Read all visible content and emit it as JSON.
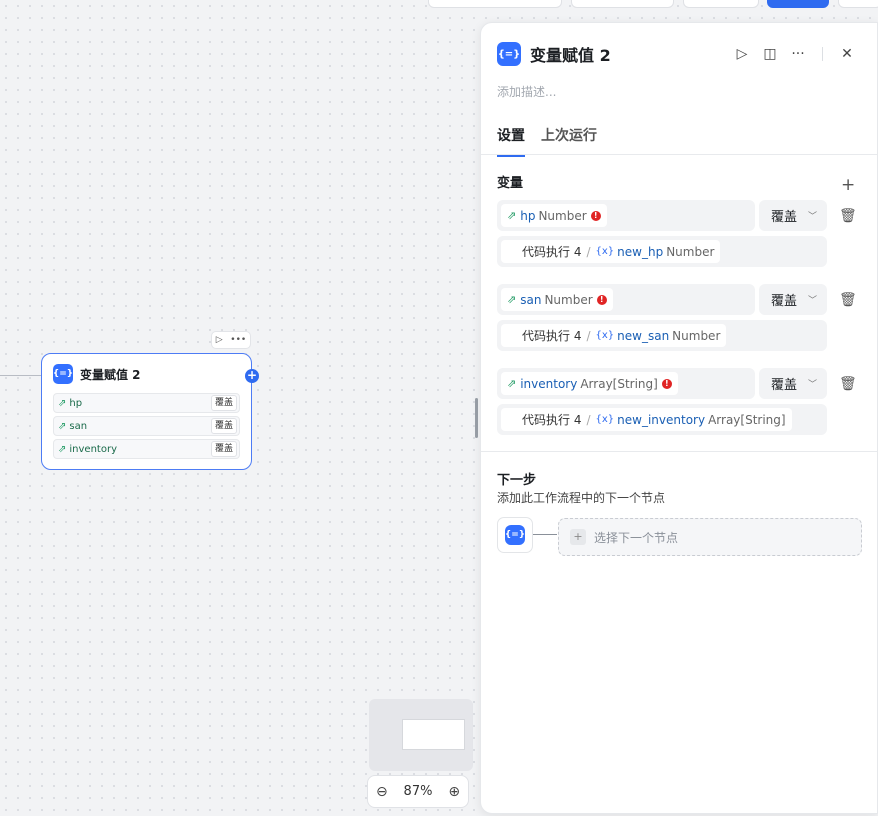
{
  "canvas": {
    "node": {
      "title": "变量赋值 2",
      "icon": "variable-assign-icon",
      "tools": {
        "run": "▷",
        "more": "•••"
      },
      "rows": [
        {
          "name": "hp",
          "mode": "覆盖"
        },
        {
          "name": "san",
          "mode": "覆盖"
        },
        {
          "name": "inventory",
          "mode": "覆盖"
        }
      ]
    },
    "zoom": {
      "level": "87%"
    }
  },
  "panel": {
    "title": "变量赋值 2",
    "description_placeholder": "添加描述...",
    "tabs": [
      "设置",
      "上次运行"
    ],
    "variables_label": "变量",
    "variables": [
      {
        "name": "hp",
        "type": "Number",
        "mode": "覆盖",
        "source_node": "代码执行 4",
        "source_var": "new_hp",
        "source_type": "Number"
      },
      {
        "name": "san",
        "type": "Number",
        "mode": "覆盖",
        "source_node": "代码执行 4",
        "source_var": "new_san",
        "source_type": "Number"
      },
      {
        "name": "inventory",
        "type": "Array[String]",
        "mode": "覆盖",
        "source_node": "代码执行 4",
        "source_var": "new_inventory",
        "source_type": "Array[String]"
      }
    ],
    "next_step": {
      "title": "下一步",
      "description": "添加此工作流程中的下一个节点",
      "select_placeholder": "选择下一个节点"
    }
  },
  "colors": {
    "accent": "#2f6bf0",
    "error": "#e02424",
    "variable_green": "#1f9a63"
  }
}
